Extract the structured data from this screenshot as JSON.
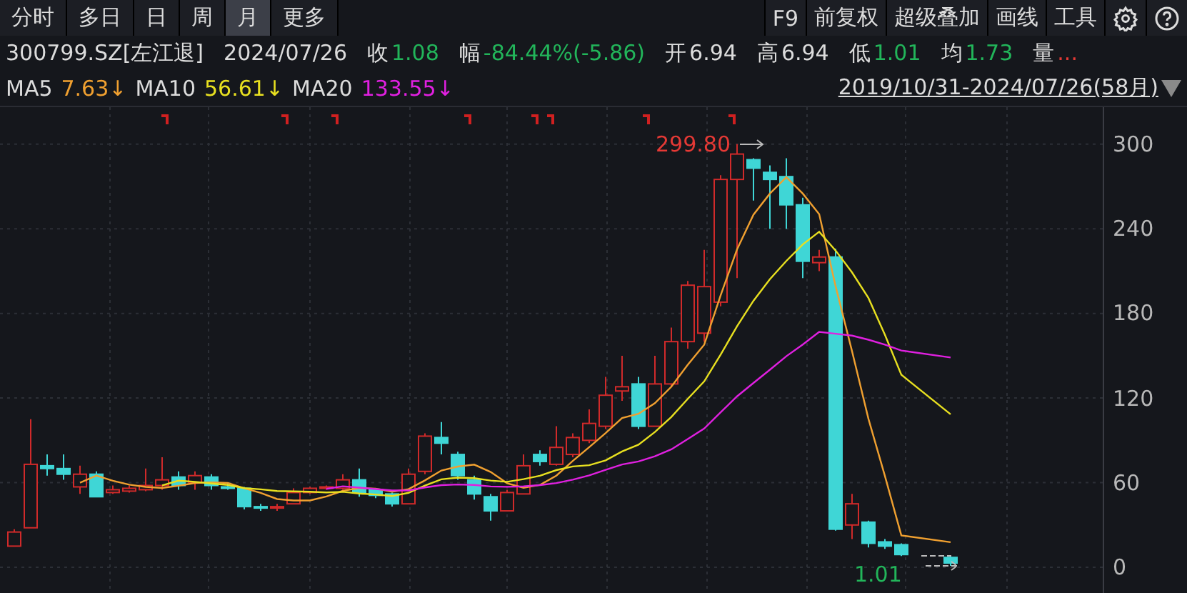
{
  "period_tabs": [
    {
      "label": "分时",
      "selected": false
    },
    {
      "label": "多日",
      "selected": false
    },
    {
      "label": "日",
      "selected": false
    },
    {
      "label": "周",
      "selected": false
    },
    {
      "label": "月",
      "selected": true
    },
    {
      "label": "更多",
      "selected": false
    }
  ],
  "toolbar": {
    "buttons": [
      "F9",
      "前复权",
      "超级叠加",
      "画线",
      "工具"
    ]
  },
  "quote": {
    "symbol": "300799.SZ[左江退]",
    "date": "2024/07/26",
    "fields": [
      {
        "label": "收",
        "value": "1.08",
        "color": "#22b55a"
      },
      {
        "label": "幅",
        "value": "-84.44%(-5.86)",
        "color": "#22b55a"
      },
      {
        "label": "开",
        "value": "6.94",
        "color": "#dcdcdc"
      },
      {
        "label": "高",
        "value": "6.94",
        "color": "#dcdcdc"
      },
      {
        "label": "低",
        "value": "1.01",
        "color": "#22b55a"
      },
      {
        "label": "均",
        "value": "1.73",
        "color": "#22b55a"
      },
      {
        "label": "量",
        "value": "...",
        "color": "#e53935"
      }
    ]
  },
  "moving_averages": [
    {
      "label": "MA5",
      "value": "7.63↓",
      "color": "#f0a030"
    },
    {
      "label": "MA10",
      "value": "56.61↓",
      "color": "#e8e020"
    },
    {
      "label": "MA20",
      "value": "133.55↓",
      "color": "#e020e0"
    }
  ],
  "range": "2019/10/31-2024/07/26(58月)",
  "chart": {
    "y_ticks": [
      "300",
      "240",
      "180",
      "120",
      "60",
      "0"
    ],
    "high_label": "299.80",
    "low_label": "1.01"
  }
}
